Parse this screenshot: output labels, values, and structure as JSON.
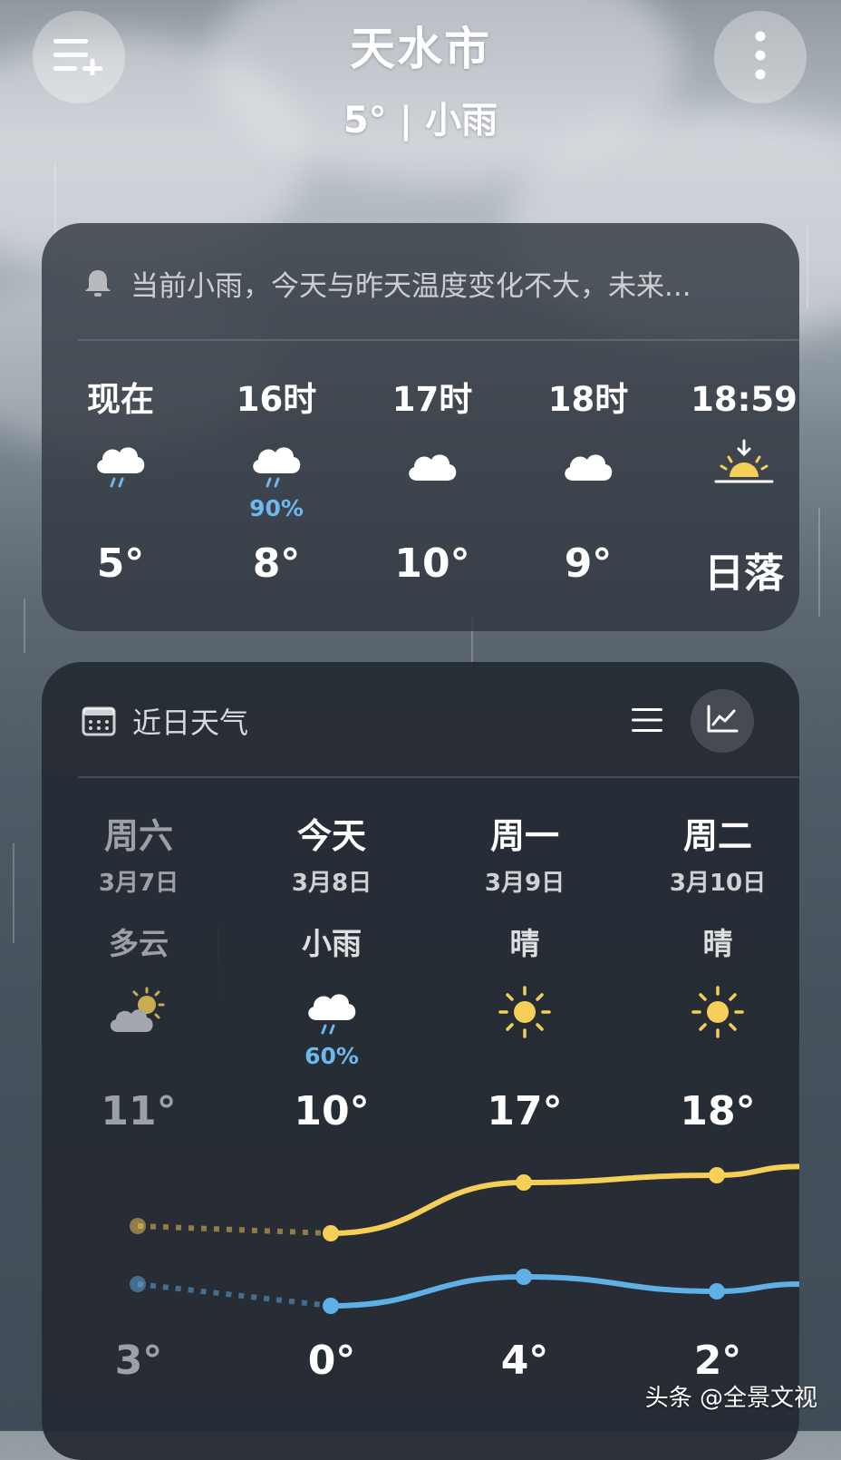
{
  "header": {
    "city": "天水市",
    "current": "5° | 小雨",
    "menu_icon": "add-city-list-icon",
    "more_icon": "more-vert-icon"
  },
  "hourly_card": {
    "notice": "当前小雨，今天与昨天温度变化不大，未来...",
    "hours": [
      {
        "label": "现在",
        "icon": "rain",
        "pop": "",
        "value": "5°"
      },
      {
        "label": "16时",
        "icon": "rain",
        "pop": "90%",
        "value": "8°"
      },
      {
        "label": "17时",
        "icon": "cloud",
        "pop": "",
        "value": "10°"
      },
      {
        "label": "18时",
        "icon": "cloud",
        "pop": "",
        "value": "9°"
      },
      {
        "label": "18:59",
        "icon": "sunset",
        "pop": "",
        "value": "日落"
      }
    ]
  },
  "daily_card": {
    "title": "近日天气",
    "days": [
      {
        "name": "周六",
        "date": "3月7日",
        "cond": "多云",
        "icon": "partly-cloudy",
        "pop": "",
        "high": "11°",
        "low": "3°",
        "past": true
      },
      {
        "name": "今天",
        "date": "3月8日",
        "cond": "小雨",
        "icon": "rain",
        "pop": "60%",
        "high": "10°",
        "low": "0°",
        "past": false
      },
      {
        "name": "周一",
        "date": "3月9日",
        "cond": "晴",
        "icon": "sun",
        "pop": "",
        "high": "17°",
        "low": "4°",
        "past": false
      },
      {
        "name": "周二",
        "date": "3月10日",
        "cond": "晴",
        "icon": "sun",
        "pop": "",
        "high": "18°",
        "low": "2°",
        "past": false
      }
    ],
    "high_temps": [
      11,
      10,
      17,
      18
    ],
    "low_temps": [
      3,
      0,
      4,
      2
    ],
    "colors": {
      "high": "#f5cf57",
      "low": "#5fb0e6"
    }
  },
  "watermark": "头条 @全景文视"
}
